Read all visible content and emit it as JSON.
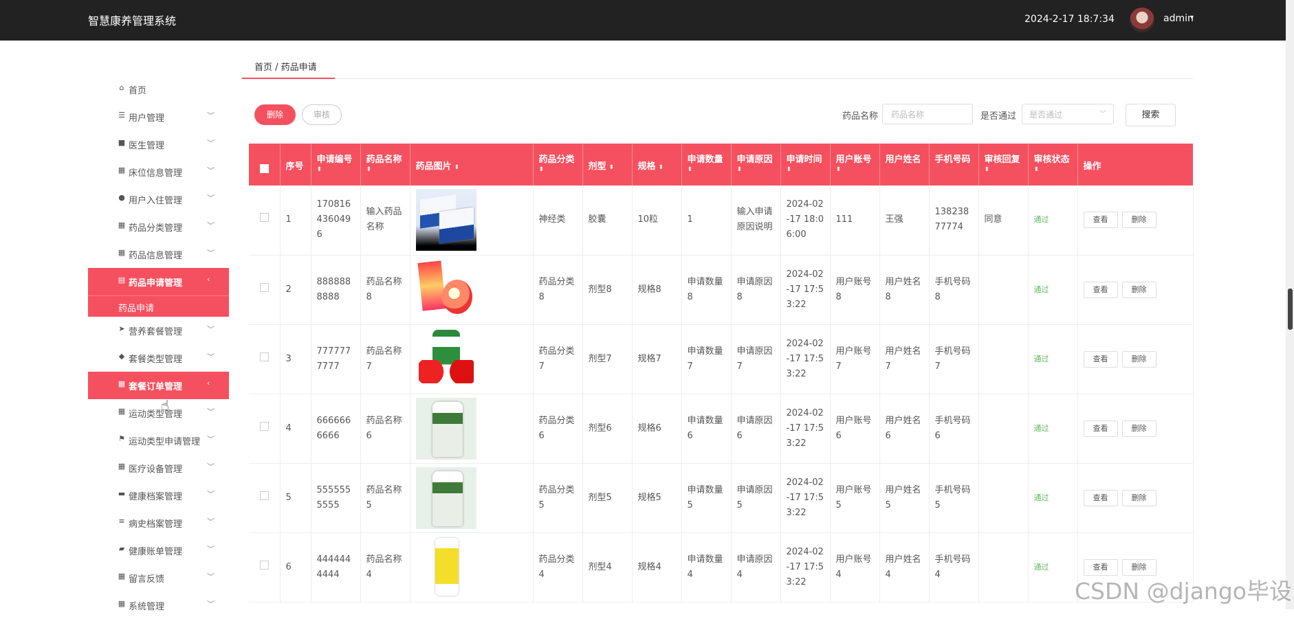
{
  "header": {
    "app_title": "智慧康养管理系统",
    "datetime": "2024-2-17 18:7:34",
    "username": "admin",
    "caret": "▾"
  },
  "sidebar": {
    "items": [
      {
        "label": "首页",
        "icon": "home-icon",
        "glyph": "⌂",
        "chevron": ""
      },
      {
        "label": "用户管理",
        "icon": "sliders-icon",
        "glyph": "☰",
        "chevron": "﹀"
      },
      {
        "label": "医生管理",
        "icon": "briefcase-icon",
        "glyph": "■",
        "chevron": "﹀"
      },
      {
        "label": "床位信息管理",
        "icon": "grid-icon",
        "glyph": "▦",
        "chevron": "﹀"
      },
      {
        "label": "用户入住管理",
        "icon": "pin-icon",
        "glyph": "●",
        "chevron": "﹀"
      },
      {
        "label": "药品分类管理",
        "icon": "grid-icon",
        "glyph": "▦",
        "chevron": "﹀"
      },
      {
        "label": "药品信息管理",
        "icon": "grid-icon",
        "glyph": "▦",
        "chevron": "﹀"
      },
      {
        "label": "药品申请管理",
        "icon": "doc-icon",
        "glyph": "▤",
        "chevron": "‹",
        "active": true,
        "sub": "药品申请"
      },
      {
        "label": "营养套餐管理",
        "icon": "plane-icon",
        "glyph": "➤",
        "chevron": "﹀"
      },
      {
        "label": "套餐类型管理",
        "icon": "tags-icon",
        "glyph": "◆",
        "chevron": "﹀"
      },
      {
        "label": "套餐订单管理",
        "icon": "grid-icon",
        "glyph": "▦",
        "chevron": "‹",
        "active": true
      },
      {
        "label": "运动类型管理",
        "icon": "grid-icon",
        "glyph": "▦",
        "chevron": "﹀"
      },
      {
        "label": "运动类型申请管理",
        "icon": "flag-icon",
        "glyph": "⚑",
        "chevron": "﹀"
      },
      {
        "label": "医疗设备管理",
        "icon": "grid-icon",
        "glyph": "▦",
        "chevron": "﹀"
      },
      {
        "label": "健康档案管理",
        "icon": "comment-icon",
        "glyph": "▬",
        "chevron": "﹀"
      },
      {
        "label": "病史档案管理",
        "icon": "list-icon",
        "glyph": "≡",
        "chevron": "﹀"
      },
      {
        "label": "健康账单管理",
        "icon": "wallet-icon",
        "glyph": "▰",
        "chevron": "﹀"
      },
      {
        "label": "留言反馈",
        "icon": "grid-icon",
        "glyph": "▦",
        "chevron": "﹀"
      },
      {
        "label": "系统管理",
        "icon": "grid-icon",
        "glyph": "▦",
        "chevron": "﹀"
      }
    ]
  },
  "breadcrumb": "首页 / 药品申请",
  "toolbar": {
    "delete_label": "删除",
    "audit_label": "审核",
    "name_label": "药品名称",
    "name_placeholder": "药品名称",
    "pass_label": "是否通过",
    "pass_placeholder": "是否通过",
    "search_label": "搜索"
  },
  "table": {
    "columns": [
      "序号",
      "申请编号",
      "药品名称",
      "药品图片",
      "药品分类",
      "剂型",
      "规格",
      "申请数量",
      "申请原因",
      "申请时间",
      "用户账号",
      "用户姓名",
      "手机号码",
      "审核回复",
      "审核状态",
      "操作"
    ],
    "rows": [
      {
        "no": "1",
        "code": "1708164360496",
        "name": "输入药品名称",
        "img": "box1",
        "category": "神经类",
        "form": "胶囊",
        "spec": "10粒",
        "qty": "1",
        "reason": "输入申请原因说明",
        "time": "2024-02-17 18:06:00",
        "account": "111",
        "uname": "王强",
        "phone": "13823877774",
        "reply": "同意",
        "status": "通过"
      },
      {
        "no": "2",
        "code": "8888888888",
        "name": "药品名称8",
        "img": "box2",
        "category": "药品分类8",
        "form": "剂型8",
        "spec": "规格8",
        "qty": "申请数量8",
        "reason": "申请原因8",
        "time": "2024-02-17 17:53:22",
        "account": "用户账号8",
        "uname": "用户姓名8",
        "phone": "手机号码8",
        "reply": "",
        "status": "通过"
      },
      {
        "no": "3",
        "code": "7777777777",
        "name": "药品名称7",
        "img": "bottle3",
        "category": "药品分类7",
        "form": "剂型7",
        "spec": "规格7",
        "qty": "申请数量7",
        "reason": "申请原因7",
        "time": "2024-02-17 17:53:22",
        "account": "用户账号7",
        "uname": "用户姓名7",
        "phone": "手机号码7",
        "reply": "",
        "status": "通过"
      },
      {
        "no": "4",
        "code": "6666666666",
        "name": "药品名称6",
        "img": "bottle4",
        "category": "药品分类6",
        "form": "剂型6",
        "spec": "规格6",
        "qty": "申请数量6",
        "reason": "申请原因6",
        "time": "2024-02-17 17:53:22",
        "account": "用户账号6",
        "uname": "用户姓名6",
        "phone": "手机号码6",
        "reply": "",
        "status": "通过"
      },
      {
        "no": "5",
        "code": "5555555555",
        "name": "药品名称5",
        "img": "bottle4",
        "category": "药品分类5",
        "form": "剂型5",
        "spec": "规格5",
        "qty": "申请数量5",
        "reason": "申请原因5",
        "time": "2024-02-17 17:53:22",
        "account": "用户账号5",
        "uname": "用户姓名5",
        "phone": "手机号码5",
        "reply": "",
        "status": "通过"
      },
      {
        "no": "6",
        "code": "4444444444",
        "name": "药品名称4",
        "img": "bottle6",
        "category": "药品分类4",
        "form": "剂型4",
        "spec": "规格4",
        "qty": "申请数量4",
        "reason": "申请原因4",
        "time": "2024-02-17 17:53:22",
        "account": "用户账号4",
        "uname": "用户姓名4",
        "phone": "手机号码4",
        "reply": "",
        "status": "通过"
      }
    ],
    "view_label": "查看",
    "delete_label": "删除"
  },
  "watermark": "CSDN @django毕设",
  "colors": {
    "accent": "#f5505f",
    "topbar": "#222222",
    "pass": "#5fb85f"
  }
}
